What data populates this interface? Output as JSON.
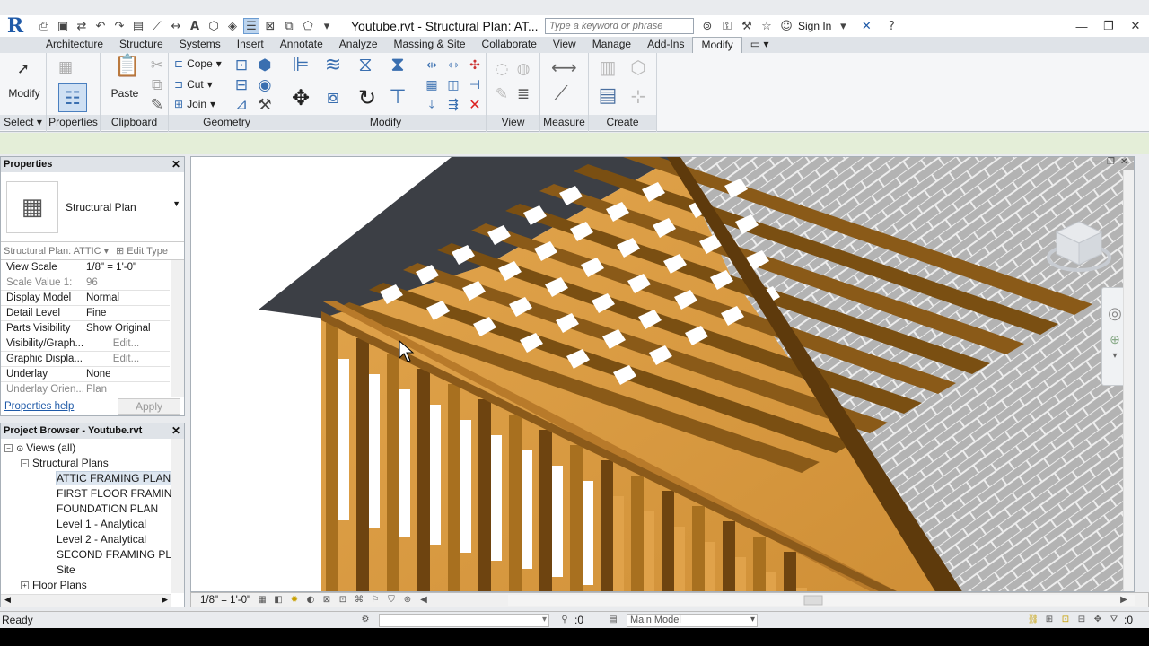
{
  "titlebar": {
    "logo": "R",
    "title": "Youtube.rvt - Structural Plan: AT...",
    "search_placeholder": "Type a keyword or phrase",
    "sign_in": "Sign In"
  },
  "tabs": [
    "Architecture",
    "Structure",
    "Systems",
    "Insert",
    "Annotate",
    "Analyze",
    "Massing & Site",
    "Collaborate",
    "View",
    "Manage",
    "Add-Ins",
    "Modify"
  ],
  "active_tab": "Modify",
  "ribbon": {
    "modify_label": "Modify",
    "paste_label": "Paste",
    "cope_label": "Cope",
    "cut_label": "Cut",
    "join_label": "Join",
    "panels": {
      "select": "Select",
      "properties": "Properties",
      "clipboard": "Clipboard",
      "geometry": "Geometry",
      "modify": "Modify",
      "view": "View",
      "measure": "Measure",
      "create": "Create"
    }
  },
  "properties": {
    "title": "Properties",
    "type_name": "Structural Plan",
    "instance_filter": "Structural Plan: ATTIC",
    "edit_type": "Edit Type",
    "rows": [
      {
        "name": "View Scale",
        "value": "1/8\" = 1'-0\"",
        "grey": false,
        "button": false
      },
      {
        "name": "Scale Value    1:",
        "value": "96",
        "grey": true,
        "button": false
      },
      {
        "name": "Display Model",
        "value": "Normal",
        "grey": false,
        "button": false
      },
      {
        "name": "Detail Level",
        "value": "Fine",
        "grey": false,
        "button": false
      },
      {
        "name": "Parts Visibility",
        "value": "Show Original",
        "grey": false,
        "button": false
      },
      {
        "name": "Visibility/Graph...",
        "value": "Edit...",
        "grey": false,
        "button": true
      },
      {
        "name": "Graphic Displa...",
        "value": "Edit...",
        "grey": false,
        "button": true
      },
      {
        "name": "Underlay",
        "value": "None",
        "grey": false,
        "button": false
      },
      {
        "name": "Underlay Orien...",
        "value": "Plan",
        "grey": true,
        "button": false
      }
    ],
    "help_link": "Properties help",
    "apply_label": "Apply"
  },
  "browser": {
    "title": "Project Browser - Youtube.rvt",
    "items": [
      {
        "label": "Views (all)",
        "level": 0,
        "toggle": "−",
        "selected": false
      },
      {
        "label": "Structural Plans",
        "level": 1,
        "toggle": "−",
        "selected": false
      },
      {
        "label": "ATTIC FRAMING PLAN",
        "level": 2,
        "toggle": "",
        "selected": true
      },
      {
        "label": "FIRST FLOOR FRAMING P",
        "level": 2,
        "toggle": "",
        "selected": false
      },
      {
        "label": "FOUNDATION PLAN",
        "level": 2,
        "toggle": "",
        "selected": false
      },
      {
        "label": "Level 1 - Analytical",
        "level": 2,
        "toggle": "",
        "selected": false
      },
      {
        "label": "Level 2 - Analytical",
        "level": 2,
        "toggle": "",
        "selected": false
      },
      {
        "label": "SECOND FRAMING PLAN",
        "level": 2,
        "toggle": "",
        "selected": false
      },
      {
        "label": "Site",
        "level": 2,
        "toggle": "",
        "selected": false
      },
      {
        "label": "Floor Plans",
        "level": 1,
        "toggle": "+",
        "selected": false
      }
    ]
  },
  "view_controls": {
    "scale": "1/8\" = 1'-0\""
  },
  "status": {
    "text": "Ready",
    "selection_count": ":0",
    "model": "Main Model",
    "filter_count": ":0"
  },
  "colors": {
    "wood_light": "#d9a04a",
    "wood_dark": "#7a4f12",
    "roof": "#3c3f45",
    "shingle": "#a8a8a8"
  }
}
